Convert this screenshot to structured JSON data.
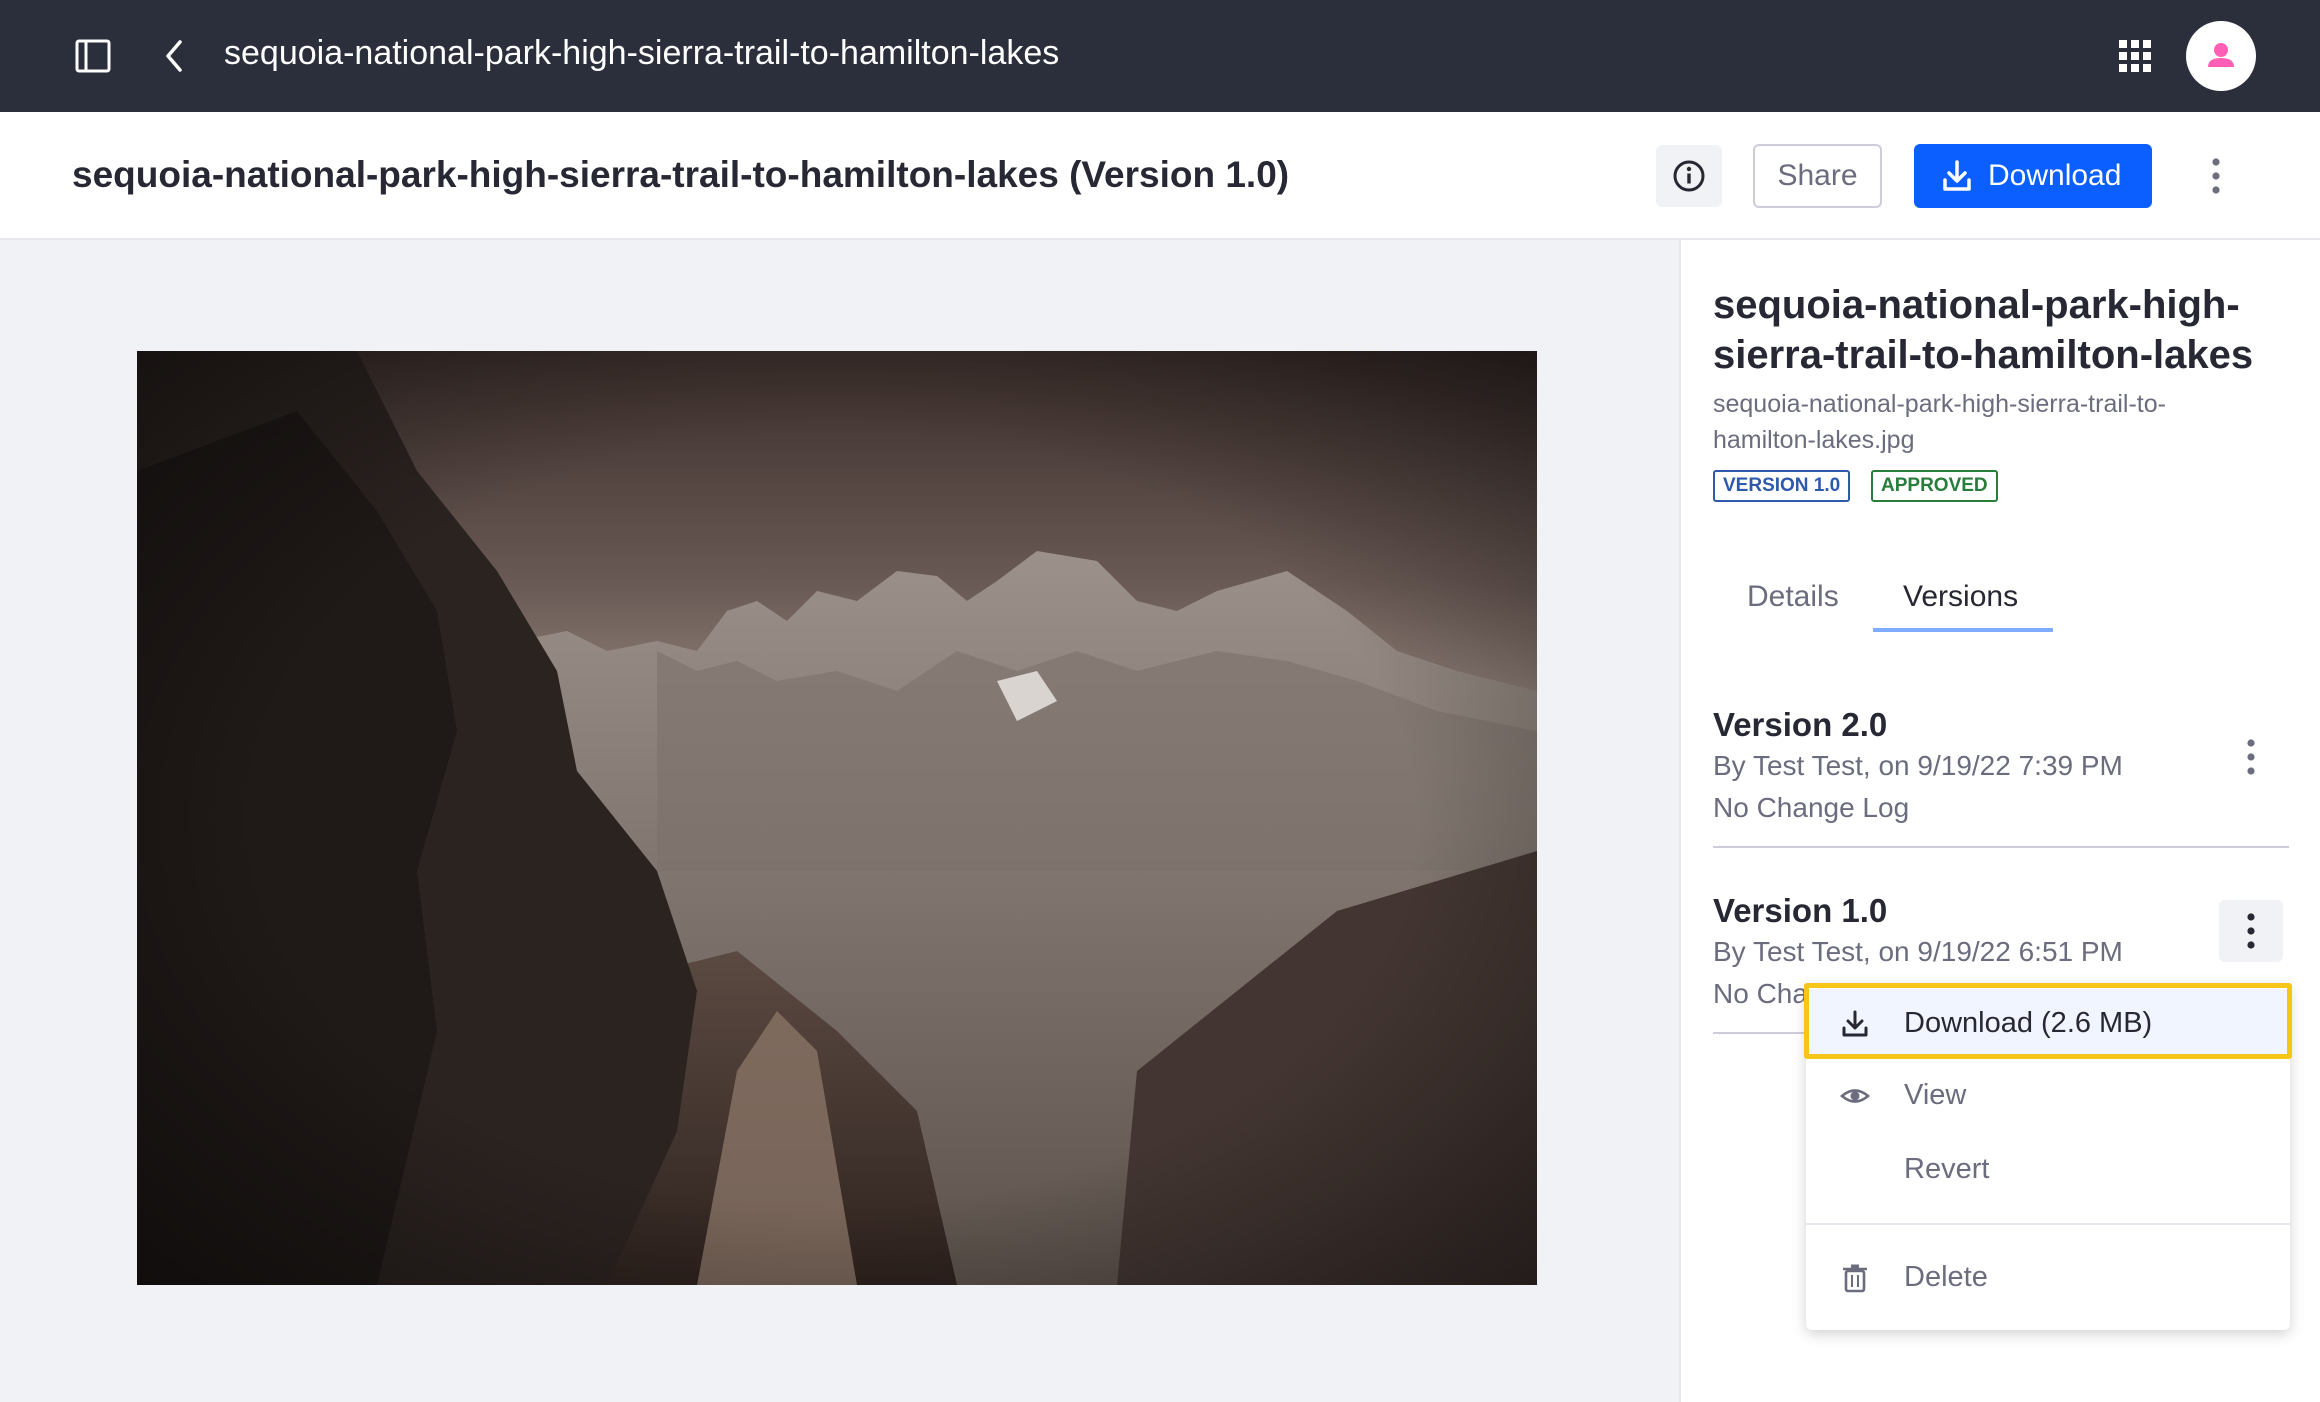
{
  "topbar": {
    "title": "sequoia-national-park-high-sierra-trail-to-hamilton-lakes",
    "icons": [
      "sidebar-panel-icon",
      "chevron-left-icon",
      "apps-grid-icon",
      "user-avatar-icon"
    ]
  },
  "header": {
    "title": "sequoia-national-park-high-sierra-trail-to-hamilton-lakes (Version 1.0)",
    "share_label": "Share",
    "download_label": "Download",
    "accent": "#0b5fff"
  },
  "sidebar": {
    "title": "sequoia-national-park-high-sierra-trail-to-hamilton-lakes",
    "file_name": "sequoia-national-park-high-sierra-trail-to-hamilton-lakes.jpg",
    "badge_version": "VERSION 1.0",
    "badge_status": "APPROVED",
    "tabs": [
      {
        "label": "Details",
        "active": false
      },
      {
        "label": "Versions",
        "active": true
      }
    ],
    "versions": [
      {
        "title": "Version 2.0",
        "by": "By Test Test, on 9/19/22 7:39 PM",
        "log": "No Change Log"
      },
      {
        "title": "Version 1.0",
        "by": "By Test Test, on 9/19/22 6:51 PM",
        "log": "No Cha"
      }
    ]
  },
  "menu": {
    "download": "Download (2.6 MB)",
    "view": "View",
    "revert": "Revert",
    "delete": "Delete"
  }
}
